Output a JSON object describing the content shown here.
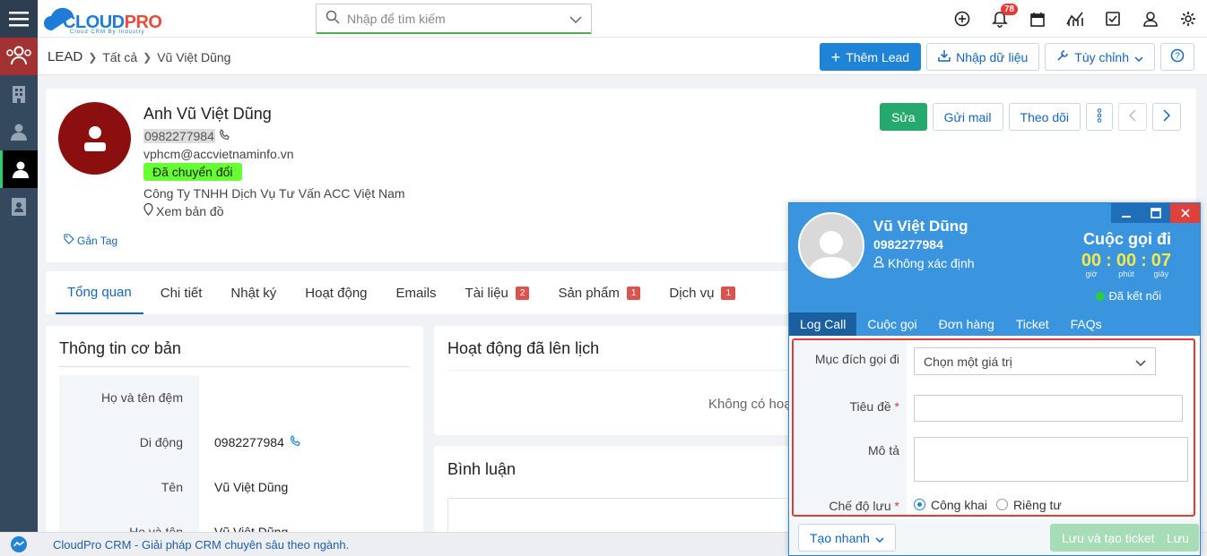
{
  "brand": {
    "name_part1": "CLOUD",
    "name_part2": "PRO",
    "tagline": "Cloud CRM By Industry"
  },
  "search": {
    "placeholder": "Nhập để tìm kiếm"
  },
  "notifications": {
    "count": "78"
  },
  "breadcrumb": {
    "module": "LEAD",
    "list": "Tất cả",
    "record": "Vũ Việt Dũng"
  },
  "toolbar": {
    "add_lead": "Thêm Lead",
    "import": "Nhập dữ liệu",
    "customize": "Tùy chỉnh"
  },
  "profile": {
    "name": "Anh Vũ Việt Dũng",
    "phone": "0982277984",
    "email": "vphcm@accvietnaminfo.vn",
    "status": "Đã chuyển đổi",
    "company": "Công Ty TNHH Dịch Vụ Tư Vấn ACC Việt Nam",
    "map_link": "Xem bản đồ",
    "tag_link": "Gắn Tag",
    "actions": {
      "edit": "Sửa",
      "send_mail": "Gửi mail",
      "follow": "Theo dõi"
    }
  },
  "tabs": [
    {
      "label": "Tổng quan",
      "count": ""
    },
    {
      "label": "Chi tiết",
      "count": ""
    },
    {
      "label": "Nhật ký",
      "count": ""
    },
    {
      "label": "Hoạt động",
      "count": ""
    },
    {
      "label": "Emails",
      "count": ""
    },
    {
      "label": "Tài liệu",
      "count": "2"
    },
    {
      "label": "Sản phẩm",
      "count": "1"
    },
    {
      "label": "Dịch vụ",
      "count": "1"
    }
  ],
  "basic_info": {
    "title": "Thông tin cơ bản",
    "rows": [
      {
        "label": "Họ và tên đệm",
        "value": ""
      },
      {
        "label": "Di động",
        "value": "0982277984"
      },
      {
        "label": "Tên",
        "value": "Vũ Việt Dũng"
      },
      {
        "label": "Họ và tên",
        "value": "Vũ Việt Dũng"
      }
    ]
  },
  "scheduled": {
    "title": "Hoạt động đã lên lịch",
    "empty": "Không có hoạ"
  },
  "comments": {
    "title": "Bình luận"
  },
  "footer": {
    "text": "CloudPro CRM - Giải pháp CRM chuyên sâu theo ngành."
  },
  "call_popup": {
    "caller_name": "Vũ Việt Dũng",
    "caller_phone": "0982277984",
    "caller_status": "Không xác định",
    "call_type": "Cuộc gọi đi",
    "timer": {
      "hours": "00",
      "minutes": "00",
      "seconds": "07",
      "hours_unit": "giờ",
      "minutes_unit": "phút",
      "seconds_unit": "giây"
    },
    "connection": "Đã kết nối",
    "tabs": [
      "Log Call",
      "Cuộc gọi",
      "Đơn hàng",
      "Ticket",
      "FAQs"
    ],
    "form": {
      "purpose_label": "Mục đích gọi đi",
      "purpose_value": "Chọn một giá trị",
      "title_label": "Tiêu đề",
      "desc_label": "Mô tả",
      "mode_label": "Chế độ lưu",
      "mode_public": "Công khai",
      "mode_private": "Riêng tư",
      "required_mark": "*"
    },
    "footer": {
      "quick_create": "Tạo nhanh",
      "save_ticket": "Lưu và tạo ticket",
      "save": "Lưu"
    }
  },
  "colors": {
    "accent": "#1f84d6",
    "success": "#26a96c",
    "danger": "#e53935",
    "popup_header": "#3a95de"
  }
}
